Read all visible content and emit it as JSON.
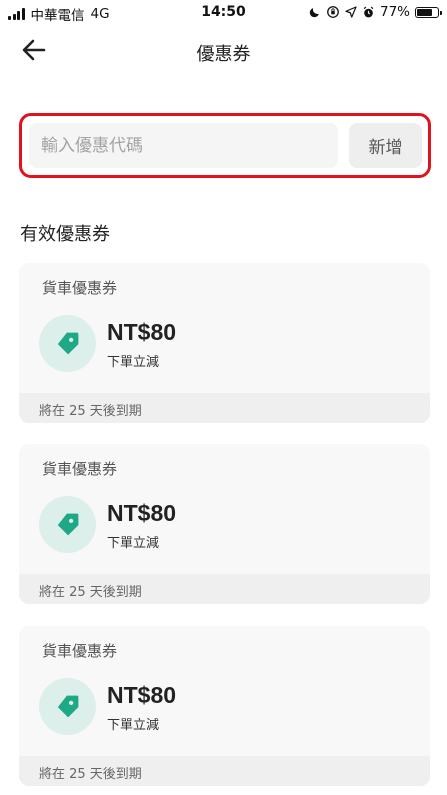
{
  "status_bar": {
    "carrier": "中華電信",
    "network": "4G",
    "time": "14:50",
    "battery": "77%",
    "battery_level": 0.77
  },
  "nav": {
    "title": "優惠券"
  },
  "promo": {
    "placeholder": "輸入優惠代碼",
    "add_label": "新增"
  },
  "section_title": "有效優惠券",
  "colors": {
    "accent": "#e0121a",
    "tag": "#1ea886",
    "tag_bg": "#dcefeb"
  },
  "coupons": [
    {
      "type": "貨車優惠券",
      "amount": "NT$80",
      "desc": "下單立減",
      "expiry": "將在 25 天後到期"
    },
    {
      "type": "貨車優惠券",
      "amount": "NT$80",
      "desc": "下單立減",
      "expiry": "將在 25 天後到期"
    },
    {
      "type": "貨車優惠券",
      "amount": "NT$80",
      "desc": "下單立減",
      "expiry": "將在 25 天後到期"
    }
  ]
}
